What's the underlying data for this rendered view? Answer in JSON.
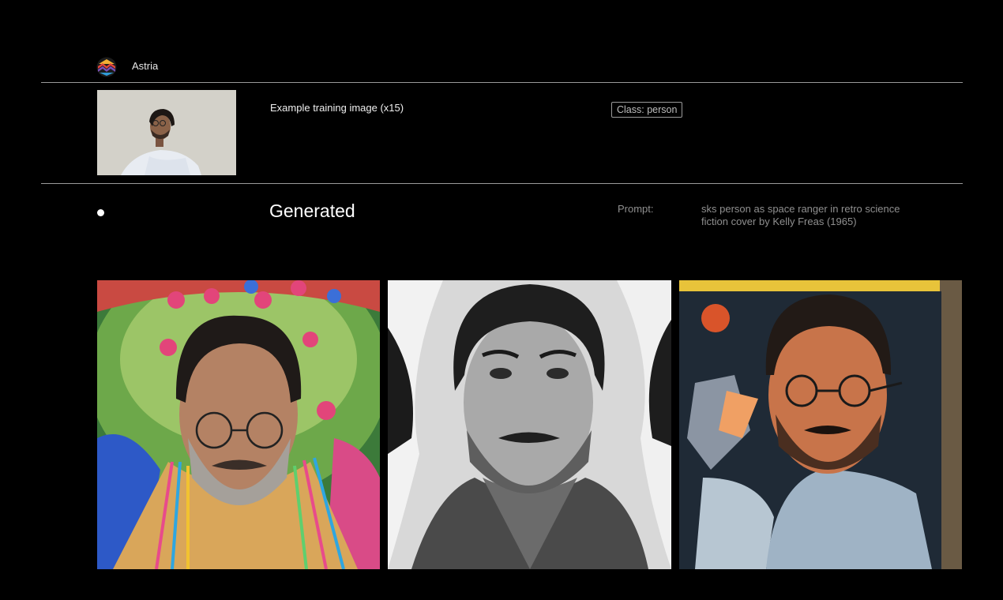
{
  "header": {
    "brand": "Astria",
    "logo_icon": "astria-logo-icon"
  },
  "training": {
    "label": "Example training image (x15)",
    "class_badge": "Class: person",
    "thumbnail": "man-with-glasses-photo"
  },
  "generated": {
    "title": "Generated",
    "prompt_label": "Prompt:",
    "prompt_text": "sks person as space ranger in retro science fiction cover by Kelly Freas (1965)",
    "images": [
      {
        "name": "colorful-headdress-portrait"
      },
      {
        "name": "black-white-portrait"
      },
      {
        "name": "retro-magazine-cover-portrait"
      }
    ]
  },
  "colors": {
    "background": "#000000",
    "rule": "#9a9a9a",
    "muted_text": "#8f8f8f"
  }
}
